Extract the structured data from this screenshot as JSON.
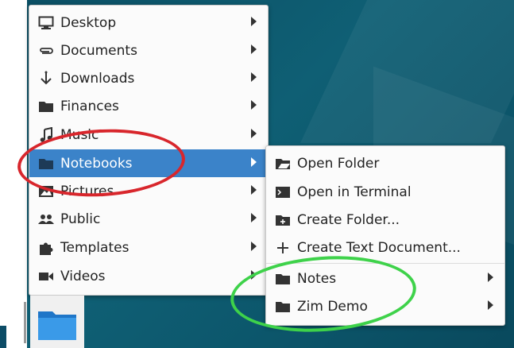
{
  "main_menu": {
    "items": [
      {
        "label": "Desktop",
        "icon": "desktop-icon",
        "has_submenu": true
      },
      {
        "label": "Documents",
        "icon": "paperclip-icon",
        "has_submenu": true
      },
      {
        "label": "Downloads",
        "icon": "download-icon",
        "has_submenu": true
      },
      {
        "label": "Finances",
        "icon": "folder-icon",
        "has_submenu": true
      },
      {
        "label": "Music",
        "icon": "music-icon",
        "has_submenu": true
      },
      {
        "label": "Notebooks",
        "icon": "folder-icon",
        "has_submenu": true,
        "selected": true
      },
      {
        "label": "Pictures",
        "icon": "picture-icon",
        "has_submenu": true
      },
      {
        "label": "Public",
        "icon": "people-icon",
        "has_submenu": true
      },
      {
        "label": "Templates",
        "icon": "puzzle-icon",
        "has_submenu": true
      },
      {
        "label": "Videos",
        "icon": "video-icon",
        "has_submenu": true
      }
    ]
  },
  "sub_menu": {
    "actions": [
      {
        "label": "Open Folder",
        "icon": "open-folder-icon"
      },
      {
        "label": "Open in Terminal",
        "icon": "terminal-icon"
      },
      {
        "label": "Create Folder...",
        "icon": "new-folder-icon"
      },
      {
        "label": "Create Text Document...",
        "icon": "plus-icon"
      }
    ],
    "folders": [
      {
        "label": "Notes",
        "icon": "folder-icon",
        "has_submenu": true
      },
      {
        "label": "Zim Demo",
        "icon": "folder-icon",
        "has_submenu": true
      }
    ]
  },
  "colors": {
    "desktop_bg": "#0b4e63",
    "menu_bg": "#fbfbfb",
    "selection": "#3b83c9",
    "annotation_red": "#d8262c",
    "annotation_green": "#3ed24a",
    "folder_blue": "#2f8fe0"
  },
  "launcher": {
    "icon": "folder-icon"
  }
}
